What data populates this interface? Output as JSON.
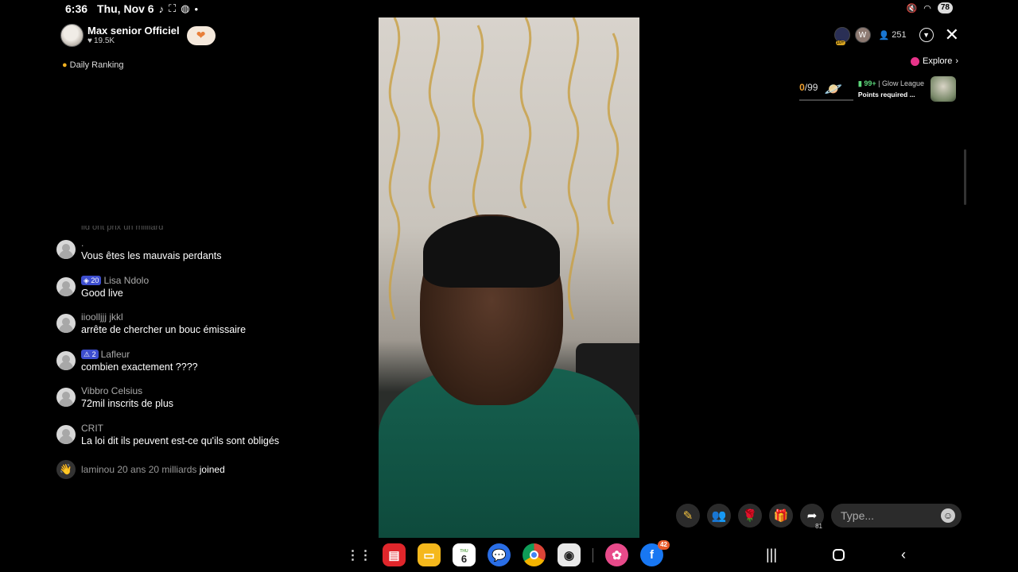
{
  "status": {
    "time": "6:36",
    "date": "Thu, Nov 6",
    "battery": "78"
  },
  "host": {
    "name": "Max senior Officiel",
    "likes": "19.5K"
  },
  "ranking_label": "Daily Ranking",
  "chat": {
    "cut_off_text": "ild ont prix  un milliard",
    "messages": [
      {
        "user": ".",
        "text": "Vous êtes les mauvais perdants",
        "badge": ""
      },
      {
        "user": "Lisa Ndolo",
        "text": "Good live",
        "badge": "20"
      },
      {
        "user": "iioolljjj jkkl",
        "text": "arrête de chercher un bouc émissaire",
        "badge": ""
      },
      {
        "user": "Lafleur",
        "text": "combien exactement ????",
        "badge": "2"
      },
      {
        "user": "Vibbro Celsius",
        "text": "72mil inscrits de plus",
        "badge": ""
      },
      {
        "user": "CRIT",
        "text": "La loi dit ils peuvent est-ce qu'ils sont obligés",
        "badge": ""
      }
    ],
    "joined": {
      "user": "laminou 20 ans 20 milliards",
      "label": "joined"
    }
  },
  "top_right": {
    "viewer_badge": "10+",
    "viewer_count": "251",
    "explore_label": "Explore"
  },
  "league": {
    "current": "0",
    "total": "/99",
    "rank": "99+",
    "name": "Glow League",
    "requirement": "Points required ..."
  },
  "actions": {
    "share_count": "81",
    "type_placeholder": "Type..."
  },
  "dock": {
    "calendar_day": "6",
    "calendar_month": "THU",
    "facebook_badge": "42"
  },
  "colors": {
    "background": "#000000",
    "shirt": "#16604f",
    "league_accent": "#5cd67a",
    "count_accent": "#f0a030",
    "explore_dot": "#e8348a"
  }
}
